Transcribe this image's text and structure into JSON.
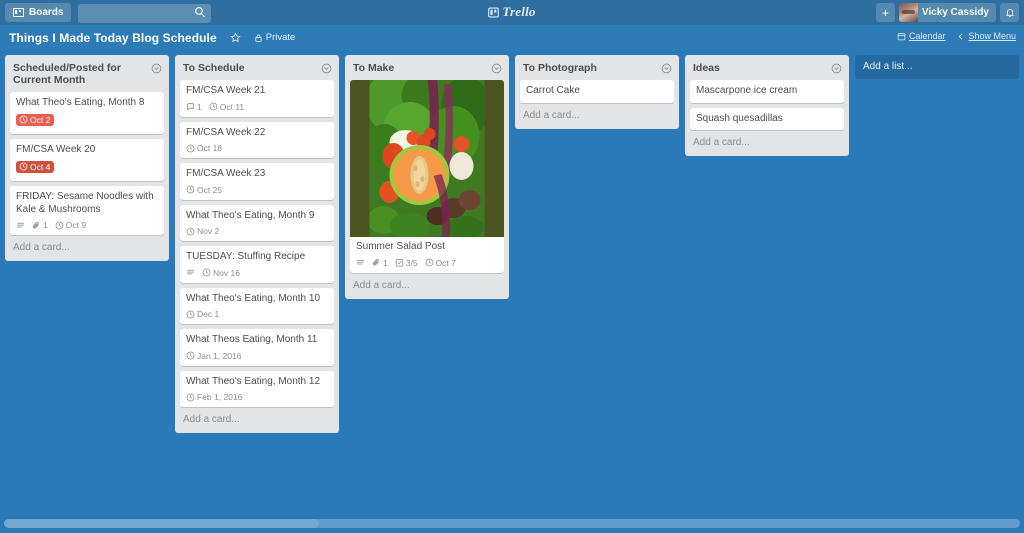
{
  "topbar": {
    "boards_label": "Boards",
    "boards_icon": "board-icon",
    "search_placeholder": "",
    "search_value": "",
    "search_icon": "search-icon",
    "logo_text": "Trello",
    "logo_icon": "trello-board-icon",
    "add_label": "+",
    "member_name": "Vicky Cassidy",
    "notifications_icon": "bell-icon"
  },
  "board_header": {
    "title": "Things I Made Today Blog Schedule",
    "star_icon": "star-icon",
    "visibility": "Private",
    "visibility_icon": "lock-icon",
    "calendar_label": "Calendar",
    "calendar_icon": "calendar-icon",
    "show_menu_label": "Show Menu",
    "show_menu_icon": "chevron-left-icon"
  },
  "colors": {
    "board_background": "#2a7ab9",
    "topbar": "#2f6f9f",
    "board_header": "#2d7cb8",
    "list_background": "#e2e4e6",
    "card_background": "#ffffff",
    "due_red_light": "#ec5f4f",
    "due_red_dark": "#cf513d",
    "cover_letterbox": "#4c5420"
  },
  "add_list_label": "Add a list...",
  "lists": [
    {
      "title": "Scheduled/Posted for Current Month",
      "menu_icon": "chevron-down-circle-icon",
      "add_card_label": "Add a card...",
      "cards": [
        {
          "title": "What Theo's Eating, Month 8",
          "due": "Oct 2",
          "due_color": "#ec5f4f",
          "due_icon": "clock-icon",
          "badges": []
        },
        {
          "title": "FM/CSA Week 20",
          "due": "Oct 4",
          "due_color": "#cf513d",
          "due_icon": "clock-icon",
          "badges": []
        },
        {
          "title": "FRIDAY: Sesame Noodles with Kale & Mushrooms",
          "badges": [
            {
              "icon": "description-icon",
              "text": ""
            },
            {
              "icon": "attachment-icon",
              "text": "1"
            },
            {
              "icon": "clock-icon",
              "text": "Oct 9"
            }
          ]
        }
      ]
    },
    {
      "title": "To Schedule",
      "menu_icon": "chevron-down-circle-icon",
      "add_card_label": "Add a card...",
      "cards": [
        {
          "title": "FM/CSA Week 21",
          "badges": [
            {
              "icon": "comment-icon",
              "text": "1"
            },
            {
              "icon": "clock-icon",
              "text": "Oct 11"
            }
          ]
        },
        {
          "title": "FM/CSA Week 22",
          "badges": [
            {
              "icon": "clock-icon",
              "text": "Oct 18"
            }
          ]
        },
        {
          "title": "FM/CSA Week 23",
          "badges": [
            {
              "icon": "clock-icon",
              "text": "Oct 25"
            }
          ]
        },
        {
          "title": "What Theo's Eating, Month 9",
          "badges": [
            {
              "icon": "clock-icon",
              "text": "Nov 2"
            }
          ]
        },
        {
          "title": "TUESDAY: Stuffing Recipe",
          "badges": [
            {
              "icon": "description-icon",
              "text": ""
            },
            {
              "icon": "clock-icon",
              "text": "Nov 16"
            }
          ]
        },
        {
          "title": "What Theo's Eating, Month 10",
          "badges": [
            {
              "icon": "clock-icon",
              "text": "Dec 1"
            }
          ]
        },
        {
          "title": "What Theos Eating, Month 11",
          "badges": [
            {
              "icon": "clock-icon",
              "text": "Jan 1, 2016"
            }
          ]
        },
        {
          "title": "What Theo's Eating, Month 12",
          "badges": [
            {
              "icon": "clock-icon",
              "text": "Feb 1, 2016"
            }
          ]
        }
      ]
    },
    {
      "title": "To Make",
      "menu_icon": "chevron-down-circle-icon",
      "add_card_label": "Add a card...",
      "cards": [
        {
          "title": "Summer Salad Post",
          "cover": "vegetables-photo",
          "badges": [
            {
              "icon": "description-icon",
              "text": ""
            },
            {
              "icon": "attachment-icon",
              "text": "1"
            },
            {
              "icon": "checklist-icon",
              "text": "3/5"
            },
            {
              "icon": "clock-icon",
              "text": "Oct 7"
            }
          ]
        }
      ]
    },
    {
      "title": "To Photograph",
      "menu_icon": "chevron-down-circle-icon",
      "add_card_label": "Add a card...",
      "cards": [
        {
          "title": "Carrot Cake",
          "badges": []
        }
      ]
    },
    {
      "title": "Ideas",
      "menu_icon": "chevron-down-circle-icon",
      "add_card_label": "Add a card...",
      "cards": [
        {
          "title": "Mascarpone ice cream",
          "badges": []
        },
        {
          "title": "Squash quesadillas",
          "badges": []
        }
      ]
    }
  ]
}
